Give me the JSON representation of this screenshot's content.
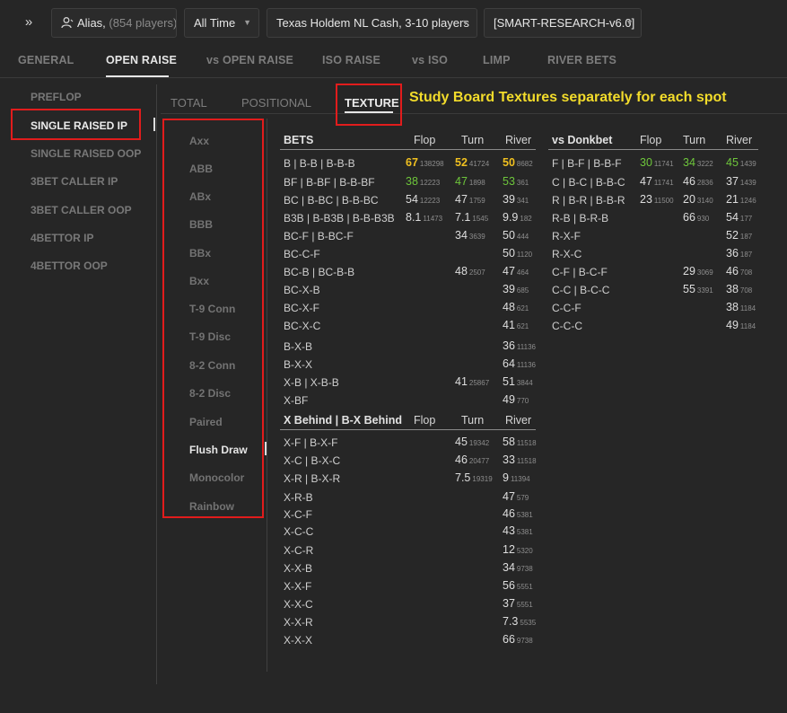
{
  "topbar": {
    "expand_icon": "double-chevron-right",
    "alias_label": "Alias,",
    "alias_count": "(854 players)",
    "time_filter": "All Time",
    "game_filter": "Texas Holdem NL Cash, 3-10 players",
    "profile": "[SMART-RESEARCH-v6.0]"
  },
  "main_tabs": [
    "GENERAL",
    "OPEN RAISE",
    "vs OPEN RAISE",
    "ISO RAISE",
    "vs ISO",
    "LIMP",
    "RIVER BETS"
  ],
  "main_tab_active": "OPEN RAISE",
  "sidebar": [
    "PREFLOP",
    "SINGLE RAISED IP",
    "SINGLE RAISED OOP",
    "3BET CALLER IP",
    "3BET CALLER OOP",
    "4BETTOR IP",
    "4BETTOR OOP"
  ],
  "sidebar_active": "SINGLE RAISED IP",
  "sub_tabs": [
    "TOTAL",
    "POSITIONAL",
    "TEXTURE"
  ],
  "sub_tab_active": "TEXTURE",
  "annotation": "Study Board Textures separately for each spot",
  "textures": [
    "Axx",
    "ABB",
    "ABx",
    "BBB",
    "BBx",
    "Bxx",
    "T-9 Conn",
    "T-9 Disc",
    "8-2 Conn",
    "8-2 Disc",
    "Paired",
    "Flush Draw",
    "Monocolor",
    "Rainbow"
  ],
  "texture_active": "Flush Draw",
  "colors": {
    "accent_red": "#e11c1c",
    "annotation_yellow": "#f3dc2b",
    "value_yellow": "#f0c020",
    "value_green": "#6ec63b"
  },
  "bets_table": {
    "headers": [
      "BETS",
      "Flop",
      "Turn",
      "River"
    ],
    "rows": [
      {
        "label": "B | B-B | B-B-B",
        "flop": [
          "67",
          "138298",
          "yellow"
        ],
        "turn": [
          "52",
          "41724",
          "yellow"
        ],
        "river": [
          "50",
          "8682",
          "yellow"
        ]
      },
      {
        "label": "BF | B-BF | B-B-BF",
        "flop": [
          "38",
          "12223",
          "green"
        ],
        "turn": [
          "47",
          "1898",
          "green"
        ],
        "river": [
          "53",
          "361",
          "green"
        ]
      },
      {
        "label": "BC | B-BC | B-B-BC",
        "flop": [
          "54",
          "12223",
          ""
        ],
        "turn": [
          "47",
          "1759",
          ""
        ],
        "river": [
          "39",
          "341",
          ""
        ]
      },
      {
        "label": "B3B | B-B3B | B-B-B3B",
        "flop": [
          "8.1",
          "11473",
          ""
        ],
        "turn": [
          "7.1",
          "1545",
          ""
        ],
        "river": [
          "9.9",
          "182",
          ""
        ]
      },
      {
        "label": "BC-F | B-BC-F",
        "turn": [
          "34",
          "3639",
          ""
        ],
        "river": [
          "50",
          "444",
          ""
        ]
      },
      {
        "label": "BC-C-F",
        "river": [
          "50",
          "1120",
          ""
        ]
      },
      {
        "label": "BC-B | BC-B-B",
        "turn": [
          "48",
          "2507",
          ""
        ],
        "river": [
          "47",
          "464",
          ""
        ]
      },
      {
        "label": "BC-X-B",
        "river": [
          "39",
          "685",
          ""
        ]
      },
      {
        "label": "BC-X-F",
        "river": [
          "48",
          "621",
          ""
        ]
      },
      {
        "label": "BC-X-C",
        "river": [
          "41",
          "621",
          ""
        ]
      },
      {
        "label": "B-X-B",
        "river": [
          "36",
          "11136",
          ""
        ]
      },
      {
        "label": "B-X-X",
        "river": [
          "64",
          "11136",
          ""
        ]
      },
      {
        "label": "X-B | X-B-B",
        "turn": [
          "41",
          "25867",
          ""
        ],
        "river": [
          "51",
          "3844",
          ""
        ]
      },
      {
        "label": "X-BF",
        "river": [
          "49",
          "770",
          ""
        ]
      }
    ]
  },
  "xbehind_table": {
    "headers": [
      "X Behind | B-X Behind",
      "Flop",
      "Turn",
      "River"
    ],
    "rows": [
      {
        "label": "X-F | B-X-F",
        "turn": [
          "45",
          "19342",
          ""
        ],
        "river": [
          "58",
          "11518",
          ""
        ]
      },
      {
        "label": "X-C | B-X-C",
        "turn": [
          "46",
          "20477",
          ""
        ],
        "river": [
          "33",
          "11518",
          ""
        ]
      },
      {
        "label": "X-R | B-X-R",
        "turn": [
          "7.5",
          "19319",
          ""
        ],
        "river": [
          "9",
          "11394",
          ""
        ]
      },
      {
        "label": "X-R-B",
        "river": [
          "47",
          "579",
          ""
        ]
      },
      {
        "label": "X-C-F",
        "river": [
          "46",
          "5381",
          ""
        ]
      },
      {
        "label": "X-C-C",
        "river": [
          "43",
          "5381",
          ""
        ]
      },
      {
        "label": "X-C-R",
        "river": [
          "12",
          "5320",
          ""
        ]
      },
      {
        "label": "X-X-B",
        "river": [
          "34",
          "9738",
          ""
        ]
      },
      {
        "label": "X-X-F",
        "river": [
          "56",
          "5551",
          ""
        ]
      },
      {
        "label": "X-X-C",
        "river": [
          "37",
          "5551",
          ""
        ]
      },
      {
        "label": "X-X-R",
        "river": [
          "7.3",
          "5535",
          ""
        ]
      },
      {
        "label": "X-X-X",
        "river": [
          "66",
          "9738",
          ""
        ]
      }
    ]
  },
  "donk_table": {
    "headers": [
      "vs Donkbet",
      "Flop",
      "Turn",
      "River"
    ],
    "rows": [
      {
        "label": "F | B-F | B-B-F",
        "flop": [
          "30",
          "11741",
          "green"
        ],
        "turn": [
          "34",
          "3222",
          "green"
        ],
        "river": [
          "45",
          "1439",
          "green"
        ]
      },
      {
        "label": "C | B-C | B-B-C",
        "flop": [
          "47",
          "11741",
          ""
        ],
        "turn": [
          "46",
          "2836",
          ""
        ],
        "river": [
          "37",
          "1439",
          ""
        ]
      },
      {
        "label": "R | B-R | B-B-R",
        "flop": [
          "23",
          "11500",
          ""
        ],
        "turn": [
          "20",
          "3140",
          ""
        ],
        "river": [
          "21",
          "1246",
          ""
        ]
      },
      {
        "label": "R-B | B-R-B",
        "turn": [
          "66",
          "930",
          ""
        ],
        "river": [
          "54",
          "177",
          ""
        ]
      },
      {
        "label": "R-X-F",
        "river": [
          "52",
          "187",
          ""
        ]
      },
      {
        "label": "R-X-C",
        "river": [
          "36",
          "187",
          ""
        ]
      },
      {
        "label": "C-F | B-C-F",
        "turn": [
          "29",
          "3069",
          ""
        ],
        "river": [
          "46",
          "708",
          ""
        ]
      },
      {
        "label": "C-C | B-C-C",
        "turn": [
          "55",
          "3391",
          ""
        ],
        "river": [
          "38",
          "708",
          ""
        ]
      },
      {
        "label": "C-C-F",
        "river": [
          "38",
          "1184",
          ""
        ]
      },
      {
        "label": "C-C-C",
        "river": [
          "49",
          "1184",
          ""
        ]
      }
    ]
  }
}
